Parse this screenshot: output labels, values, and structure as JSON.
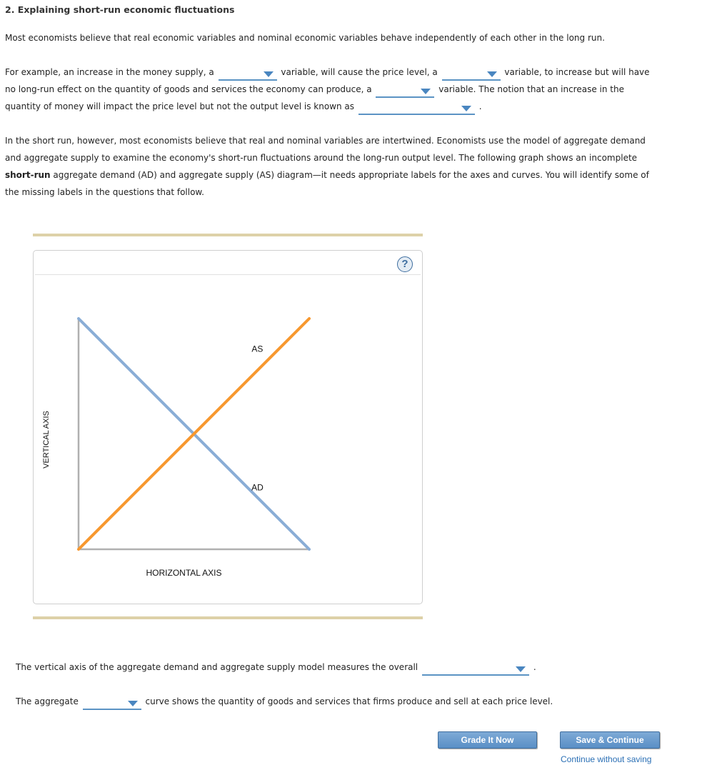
{
  "question": {
    "title": "2. Explaining short-run economic fluctuations",
    "intro": "Most economists believe that real economic variables and nominal economic variables behave independently of each other in the long run.",
    "p2": {
      "t1": "For example, an increase in the money supply, a",
      "t2": "variable, will cause the price level, a",
      "t3": "variable, to increase but will have no long-run effect on the quantity of goods and services the economy can produce, a",
      "t4": "variable. The notion that an increase in the quantity of money will impact the price level but not the output level is known as",
      "t5": "."
    },
    "p3": {
      "t1": "In the short run, however, most economists believe that real and nominal variables are intertwined. Economists use the model of aggregate demand and aggregate supply to examine the economy's short-run fluctuations around the long-run output level. The following graph shows an incomplete ",
      "bold": "short-run",
      "t2": " aggregate demand (AD) and aggregate supply (AS) diagram—it needs appropriate labels for the axes and curves. You will identify some of the missing labels in the questions that follow."
    }
  },
  "dropdowns": {
    "money_supply_type": {
      "selected": ""
    },
    "price_level_type": {
      "selected": ""
    },
    "output_type": {
      "selected": ""
    },
    "notion_name": {
      "selected": ""
    },
    "vertical_axis_measure": {
      "selected": ""
    },
    "aggregate_curve": {
      "selected": ""
    }
  },
  "graph": {
    "help_symbol": "?",
    "colors": {
      "as": "#f7982f",
      "ad": "#8aadd6",
      "axis": "#b0b0b0"
    }
  },
  "chart_data": {
    "type": "line",
    "title": "",
    "xlabel": "HORIZONTAL AXIS",
    "ylabel": "VERTICAL AXIS",
    "xlim": [
      0,
      100
    ],
    "ylim": [
      0,
      100
    ],
    "grid": false,
    "series": [
      {
        "name": "AD",
        "label": "AD",
        "x": [
          0,
          100
        ],
        "y": [
          100,
          0
        ],
        "color": "#8aadd6",
        "label_at": [
          80,
          25
        ]
      },
      {
        "name": "AS",
        "label": "AS",
        "x": [
          0,
          100
        ],
        "y": [
          0,
          100
        ],
        "color": "#f7982f",
        "label_at": [
          80,
          85
        ]
      }
    ]
  },
  "followups": {
    "q1": {
      "before": "The vertical axis of the aggregate demand and aggregate supply model measures the overall",
      "after": "."
    },
    "q2": {
      "before": "The aggregate",
      "after": "curve shows the quantity of goods and services that firms produce and sell at each price level."
    }
  },
  "actions": {
    "grade": "Grade It Now",
    "save": "Save & Continue",
    "continue": "Continue without saving"
  }
}
